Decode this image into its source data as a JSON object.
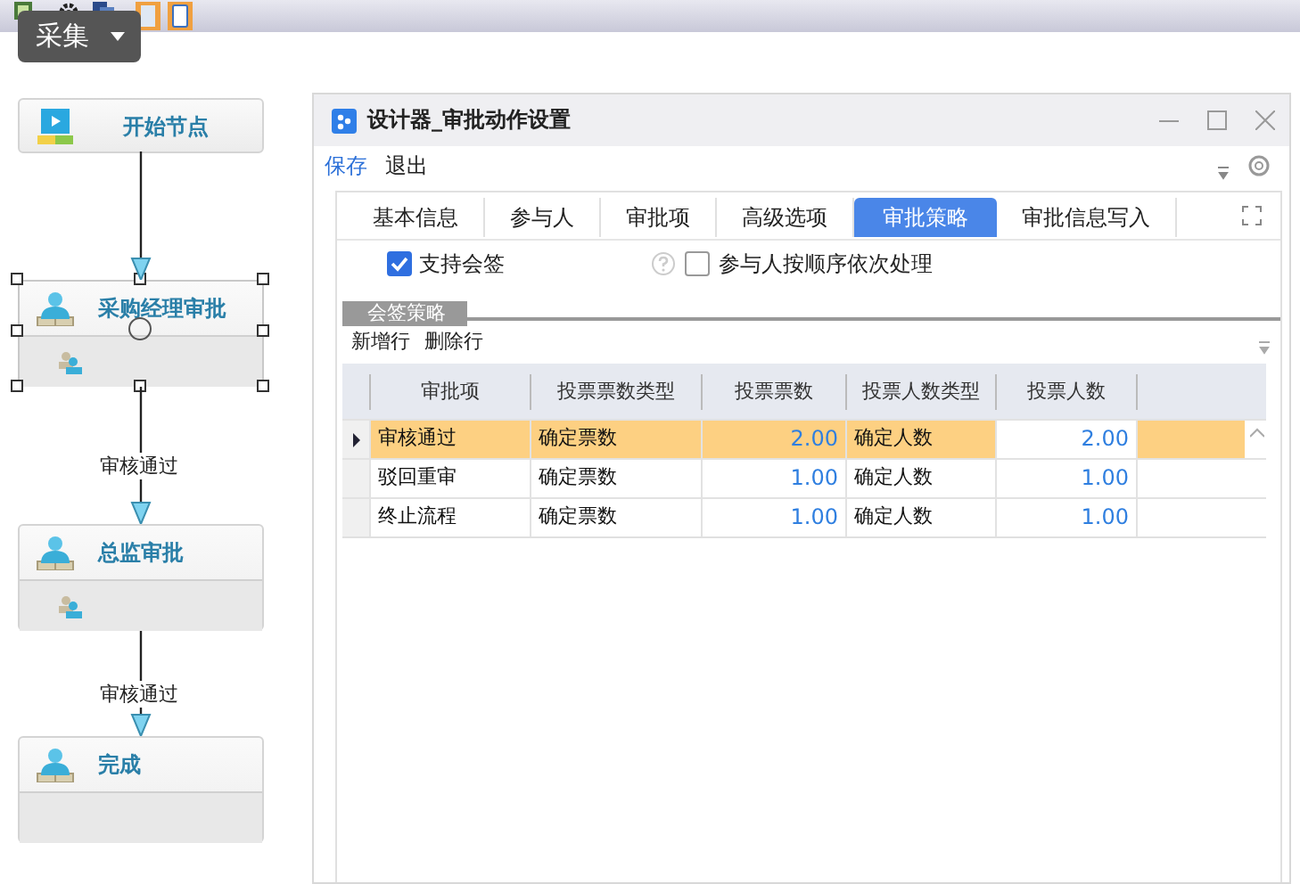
{
  "menu_button": {
    "label": "采集"
  },
  "flow": {
    "nodes": [
      {
        "kind": "start",
        "label": "开始节点",
        "selected": false
      },
      {
        "kind": "approval",
        "label": "采购经理审批",
        "selected": true
      },
      {
        "kind": "approval",
        "label": "总监审批",
        "selected": false
      },
      {
        "kind": "approval",
        "label": "完成",
        "selected": false
      }
    ],
    "edge_labels": [
      "审核通过",
      "审核通过"
    ]
  },
  "window": {
    "title": "设计器_审批动作设置",
    "toolbar": [
      {
        "label": "保存",
        "kind": "link"
      },
      {
        "label": "退出",
        "kind": "plain"
      }
    ],
    "tabs": [
      {
        "label": "基本信息",
        "selected": false
      },
      {
        "label": "参与人",
        "selected": false
      },
      {
        "label": "审批项",
        "selected": false
      },
      {
        "label": "高级选项",
        "selected": false
      },
      {
        "label": "审批策略",
        "selected": true
      },
      {
        "label": "审批信息写入",
        "selected": false
      }
    ],
    "options": [
      {
        "label": "支持会签",
        "checked": true,
        "help": false
      },
      {
        "label": "参与人按顺序依次处理",
        "checked": false,
        "help": true
      }
    ],
    "group_title": "会签策略",
    "actions": [
      "新增行",
      "删除行"
    ],
    "table": {
      "columns": [
        {
          "label": "审批项",
          "kind": "text",
          "current": false
        },
        {
          "label": "投票票数类型",
          "kind": "text",
          "current": false
        },
        {
          "label": "投票票数",
          "kind": "number",
          "current": false
        },
        {
          "label": "投票人数类型",
          "kind": "text",
          "current": false
        },
        {
          "label": "投票人数",
          "kind": "number",
          "current": true
        }
      ],
      "rows": [
        {
          "selected": true,
          "cells": [
            "审核通过",
            "确定票数",
            "2.00",
            "确定人数",
            "2.00"
          ]
        },
        {
          "selected": false,
          "cells": [
            "驳回重审",
            "确定票数",
            "1.00",
            "确定人数",
            "1.00"
          ]
        },
        {
          "selected": false,
          "cells": [
            "终止流程",
            "确定票数",
            "1.00",
            "确定人数",
            "1.00"
          ]
        }
      ]
    }
  }
}
